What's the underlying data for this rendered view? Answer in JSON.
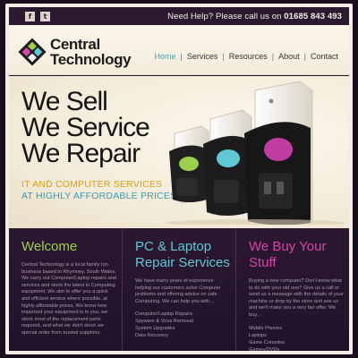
{
  "topbar": {
    "social": [
      {
        "icon": "facebook-icon",
        "glyph": "f"
      },
      {
        "icon": "twitter-icon",
        "glyph": "t"
      }
    ],
    "help_prefix": "Need Help? Please call us on",
    "phone": "01685 843 493"
  },
  "logo": {
    "line1": "Central",
    "line2": "Technology"
  },
  "nav": {
    "items": [
      {
        "label": "Home",
        "active": true
      },
      {
        "label": "Services",
        "active": false
      },
      {
        "label": "Resources",
        "active": false
      },
      {
        "label": "About",
        "active": false
      },
      {
        "label": "Contact",
        "active": false
      }
    ],
    "separator": "|"
  },
  "hero": {
    "lines": [
      "We Sell",
      "We Service",
      "We Repair"
    ],
    "sub1": "IT AND COMPUTER SERVICES",
    "sub2": "AT HIGHLY AFFORDABLE PRICES"
  },
  "columns": [
    {
      "title": "Welcome",
      "color": "#9bd14a",
      "text": "Central Technology is a local family run business based in Rhymney, South Wales. We carry out Computer/Laptop repairs and services and stock the latest in Computing equipment. We aim to offer you a quick and efficient service where possible, at highly affordable prices. We know how important your equipment is to you, we stock most of the replacement parts required, and what we don't stock we special order from trusted suppliers.",
      "list": []
    },
    {
      "title": "PC & Laptop Repair Services",
      "color": "#5ec8d6",
      "text": "We have many years of experience helping our customers solve Computer problems and offering advice on safe Computing. We can help you with...",
      "list": [
        "Computer/Laptop Repairs",
        "Spyware & Virus Removal",
        "System Upgrades",
        "Data Recovery"
      ]
    },
    {
      "title": "We Buy Your Stuff",
      "color": "#d646a8",
      "text": "Buying a new computer? Don't know what to do with your old one? Give us a call or send us a message with the details of your machine or drop by the store and see us and we'll make you a very fair offer. We buy...",
      "list": [
        "Mobile Phones",
        "Laptops",
        "Game Consoles",
        "Games/DVDs"
      ]
    }
  ]
}
